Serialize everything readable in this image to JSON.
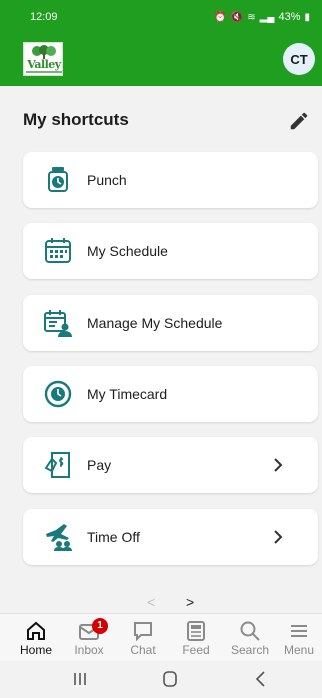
{
  "status_bar": {
    "time": "12:09",
    "battery": "43%"
  },
  "header": {
    "logo_text": "Valley",
    "avatar_initials": "CT"
  },
  "shortcuts": {
    "title": "My shortcuts",
    "items": [
      {
        "label": "Punch",
        "icon": "punch-clock-icon"
      },
      {
        "label": "My Schedule",
        "icon": "calendar-icon"
      },
      {
        "label": "Manage My Schedule",
        "icon": "manage-schedule-icon"
      },
      {
        "label": "My Timecard",
        "icon": "timecard-icon"
      },
      {
        "label": "Pay",
        "icon": "pay-icon",
        "has_chevron": true
      },
      {
        "label": "Time Off",
        "icon": "time-off-icon",
        "has_chevron": true
      }
    ]
  },
  "pager": {
    "prev": "<",
    "next": ">"
  },
  "bottom_nav": {
    "items": [
      {
        "label": "Home",
        "icon": "home-icon",
        "active": true
      },
      {
        "label": "Inbox",
        "icon": "inbox-icon",
        "badge": "1"
      },
      {
        "label": "Chat",
        "icon": "chat-icon"
      },
      {
        "label": "Feed",
        "icon": "feed-icon"
      },
      {
        "label": "Search",
        "icon": "search-icon"
      },
      {
        "label": "Menu",
        "icon": "menu-icon"
      }
    ]
  },
  "colors": {
    "brand_green": "#1f9e1f",
    "accent_teal": "#1a7a7a",
    "badge_red": "#d50000"
  }
}
